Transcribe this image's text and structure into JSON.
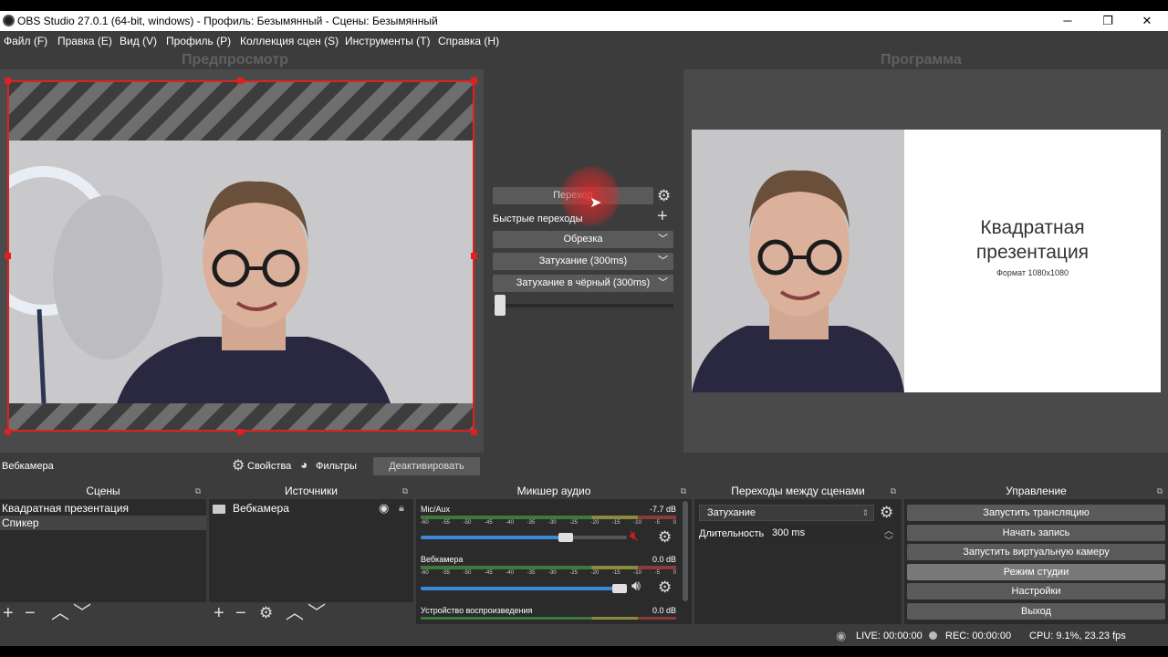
{
  "window": {
    "title": "OBS Studio 27.0.1 (64-bit, windows) - Профиль: Безымянный - Сцены: Безымянный",
    "minimize": "─",
    "restore": "❐",
    "close": "✕"
  },
  "menu": [
    "Файл (F)",
    "Правка (E)",
    "Вид (V)",
    "Профиль (P)",
    "Коллекция сцен (S)",
    "Инструменты (T)",
    "Справка (H)"
  ],
  "preview": {
    "title": "Предпросмотр"
  },
  "program": {
    "title": "Программа",
    "slide_title_line1": "Квадратная",
    "slide_title_line2": "презентация",
    "slide_subtitle": "Формат 1080х1080"
  },
  "transition_panel": {
    "transition_button": "Переход",
    "quick_transitions_label": "Быстрые переходы",
    "add": "+",
    "quick_items": [
      "Обрезка",
      "Затухание (300ms)",
      "Затухание в чёрный (300ms)"
    ]
  },
  "source_toolbar": {
    "selected_source": "Вебкамера",
    "properties": "Свойства",
    "filters": "Фильтры",
    "deactivate": "Деактивировать"
  },
  "scenes": {
    "title": "Сцены",
    "items": [
      "Квадратная презентация",
      "Спикер"
    ]
  },
  "sources": {
    "title": "Источники",
    "items": [
      "Вебкамера"
    ]
  },
  "mixer": {
    "title": "Микшер аудио",
    "ticks": [
      "-60",
      "-55",
      "-50",
      "-45",
      "-40",
      "-35",
      "-30",
      "-25",
      "-20",
      "-15",
      "-10",
      "-5",
      "0"
    ],
    "channels": [
      {
        "name": "Mic/Aux",
        "db": "-7.7 dB",
        "level": 0.72,
        "muted": true
      },
      {
        "name": "Вебкамера",
        "db": "0.0 dB",
        "level": 1.0,
        "muted": false
      },
      {
        "name": "Устройство воспроизведения",
        "db": "0.0 dB",
        "level": 1.0,
        "muted": false
      }
    ]
  },
  "scene_transitions": {
    "title": "Переходы между сценами",
    "selected": "Затухание",
    "duration_label": "Длительность",
    "duration_value": "300 ms"
  },
  "controls": {
    "title": "Управление",
    "buttons": [
      "Запустить трансляцию",
      "Начать запись",
      "Запустить виртуальную камеру",
      "Режим студии",
      "Настройки",
      "Выход"
    ]
  },
  "status": {
    "live": "LIVE: 00:00:00",
    "rec": "REC: 00:00:00",
    "cpu": "CPU: 9.1%, 23.23 fps"
  },
  "colors": {
    "selection": "#e02020",
    "accent_blue": "#3e87d8",
    "mute_red": "#d02020"
  }
}
